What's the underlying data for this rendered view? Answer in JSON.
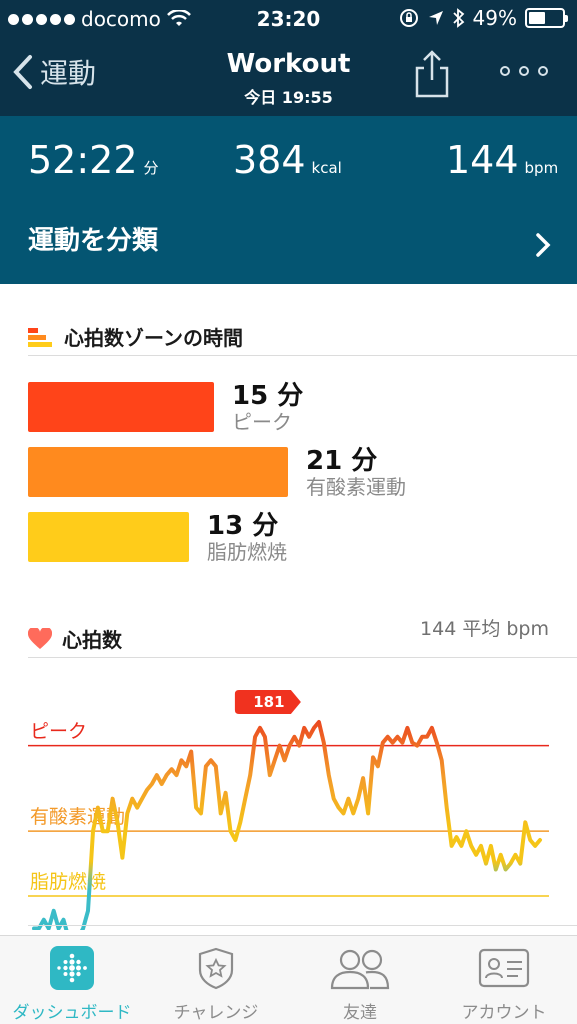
{
  "status_bar": {
    "carrier": "docomo",
    "time": "23:20",
    "battery": "49%",
    "battery_level": 0.49
  },
  "nav": {
    "back_label": "運動",
    "title": "Workout",
    "subtitle": "今日 19:55"
  },
  "stats": {
    "duration": {
      "value": "52:22",
      "unit": "分"
    },
    "calories": {
      "value": "384",
      "unit": "kcal"
    },
    "heart_rate": {
      "value": "144",
      "unit": "bpm"
    }
  },
  "classify_label": "運動を分類",
  "zones": {
    "title": "心拍数ゾーンの時間",
    "items": [
      {
        "minutes": "15 分",
        "label": "ピーク",
        "value": 15,
        "color": "#ff4419"
      },
      {
        "minutes": "21 分",
        "label": "有酸素運動",
        "value": 21,
        "color": "#ff8a1e"
      },
      {
        "minutes": "13 分",
        "label": "脂肪燃焼",
        "value": 13,
        "color": "#ffcc1a"
      }
    ]
  },
  "heart_section": {
    "title": "心拍数",
    "average": "144 平均 bpm"
  },
  "chart_data": {
    "type": "line",
    "max_label": "181",
    "threshold_labels": [
      "ピーク",
      "有酸素運動",
      "脂肪燃焼"
    ],
    "series": [
      {
        "values": [
          111,
          111,
          114,
          111,
          117,
          111,
          114,
          108,
          103,
          108,
          111,
          117,
          144,
          152,
          144,
          144,
          155,
          147,
          135,
          150,
          155,
          152,
          155,
          158,
          160,
          163,
          160,
          163,
          165,
          163,
          168,
          166,
          171,
          152,
          150,
          166,
          168,
          166,
          150,
          157,
          144,
          141,
          147,
          155,
          163,
          176,
          179,
          176,
          163,
          168,
          173,
          168,
          173,
          176,
          173,
          179,
          176,
          179,
          181,
          174,
          163,
          155,
          152,
          150,
          155,
          150,
          155,
          162,
          150,
          169,
          166,
          174,
          176,
          174,
          176,
          174,
          179,
          174,
          173,
          176,
          176,
          179,
          174,
          168,
          152,
          139,
          142,
          139,
          144,
          139,
          136,
          139,
          133,
          139,
          131,
          136,
          131,
          133,
          136,
          133,
          147,
          141,
          139,
          141
        ]
      }
    ],
    "threshold_values": {
      "peak": 173,
      "cardio": 144,
      "fat_burn": 122
    },
    "colors": {
      "peak": "#e8291c",
      "cardio": "#f39a2a",
      "fat_burn": "#f5c518",
      "low": "#3bbcc8"
    }
  },
  "tabs": [
    {
      "label": "ダッシュボード",
      "icon": "fitbit-dots-icon",
      "active": true
    },
    {
      "label": "チャレンジ",
      "icon": "star-badge-icon",
      "active": false
    },
    {
      "label": "友達",
      "icon": "friends-icon",
      "active": false
    },
    {
      "label": "アカウント",
      "icon": "account-card-icon",
      "active": false
    }
  ],
  "theme": {
    "header_dark": "#0b3248",
    "header_teal": "#045572",
    "active_tab": "#2fb8c4"
  }
}
